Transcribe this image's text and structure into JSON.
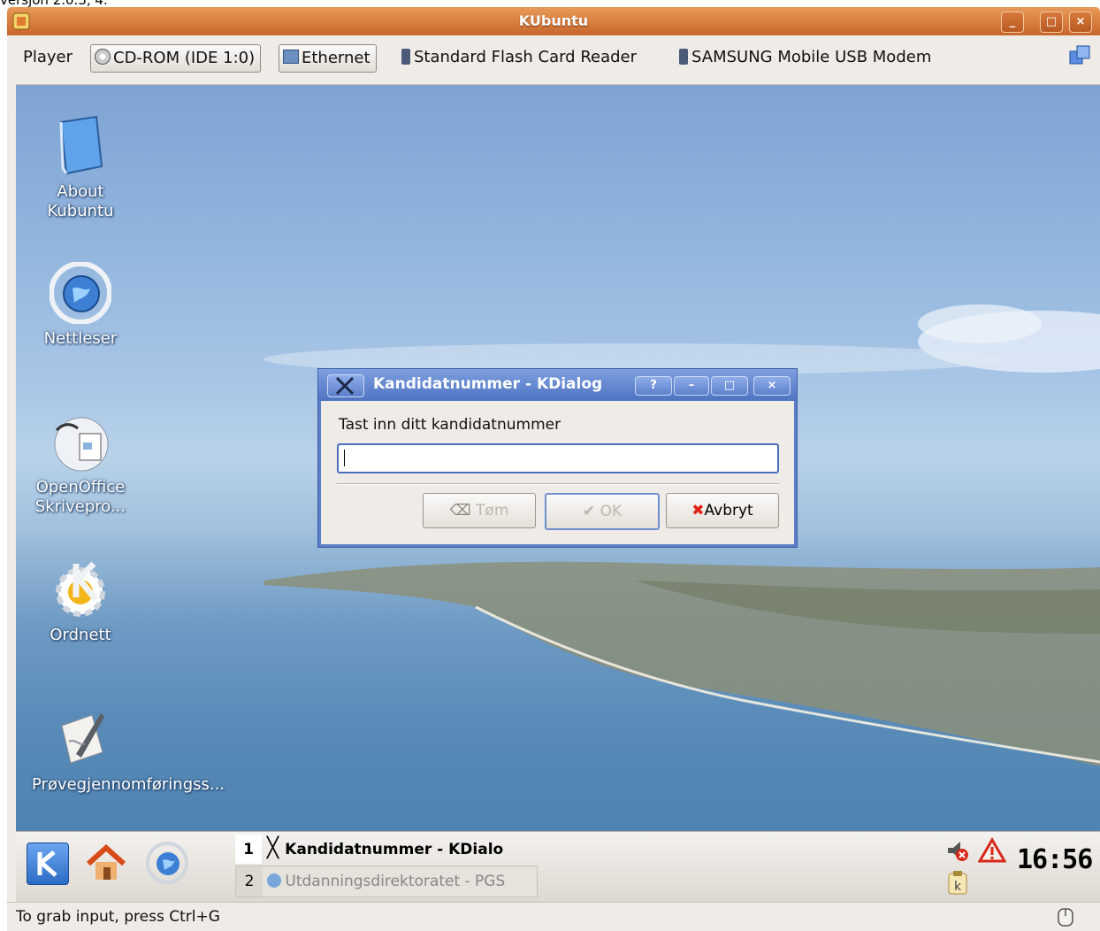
{
  "top_clipped_text": "versjon 2.0.3, 4.",
  "window": {
    "title": "KUbuntu",
    "minimize": "_",
    "maximize": "□",
    "close": "×"
  },
  "toolbar": {
    "player": "Player",
    "devices": [
      {
        "label": "CD-ROM (IDE 1:0)",
        "icon": "cdrom-icon"
      },
      {
        "label": "Ethernet",
        "icon": "network-icon"
      },
      {
        "label": "Standard Flash Card Reader",
        "icon": "usb-icon"
      },
      {
        "label": "SAMSUNG Mobile USB Modem",
        "icon": "usb-icon"
      }
    ]
  },
  "desktop": {
    "icons": [
      {
        "label": "About Kubuntu",
        "icon": "book-icon"
      },
      {
        "label": "Nettleser",
        "icon": "konqueror-globe-icon"
      },
      {
        "label": "OpenOffice Skrivepro...",
        "icon": "openoffice-writer-icon"
      },
      {
        "label": "Ordnett",
        "icon": "kde-gear-icon"
      },
      {
        "label": "Prøvegjennomføringss...",
        "icon": "quill-pen-icon"
      }
    ]
  },
  "dialog": {
    "title": "Kandidatnummer - KDialog",
    "help": "?",
    "minimize": "–",
    "maximize": "□",
    "close": "×",
    "prompt": "Tast inn ditt kandidatnummer",
    "input_value": "",
    "buttons": {
      "clear": "Tøm",
      "ok": "OK",
      "cancel": "Avbryt"
    }
  },
  "taskbar": {
    "tasks": [
      {
        "num": "1",
        "label": "Kandidatnummer - KDialo"
      },
      {
        "num": "2",
        "label": "Utdanningsdirektoratet - PGS"
      }
    ],
    "clock": "16:56"
  },
  "statusbar": {
    "text": "To grab input, press Ctrl+G"
  },
  "colors": {
    "title_orange": "#d8763a",
    "kdialog_blue": "#5a7fc8",
    "panel": "#efebe6"
  }
}
